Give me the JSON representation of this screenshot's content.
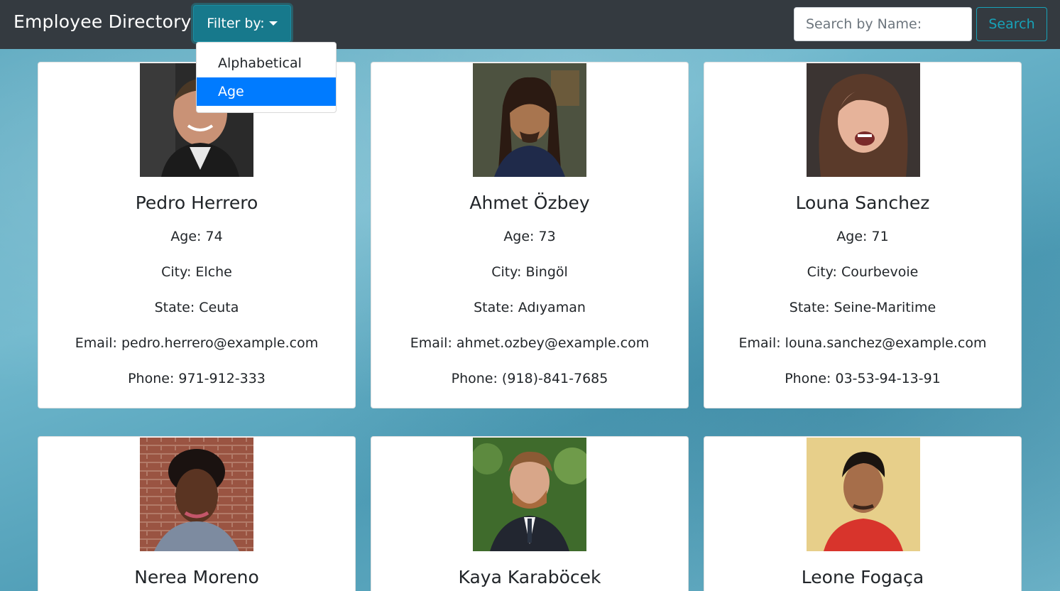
{
  "navbar": {
    "brand": "Employee Directory",
    "filter_label": "Filter by:",
    "search_placeholder": "Search by Name:",
    "search_button": "Search"
  },
  "filter_menu": {
    "items": [
      {
        "label": "Alphabetical",
        "active": false
      },
      {
        "label": "Age",
        "active": true
      }
    ]
  },
  "employees": [
    {
      "name": "Pedro Herrero",
      "age": "Age: 74",
      "city": "City: Elche",
      "state": "State: Ceuta",
      "email": "Email: pedro.herrero@example.com",
      "phone": "Phone: 971-912-333"
    },
    {
      "name": "Ahmet Özbey",
      "age": "Age: 73",
      "city": "City: Bingöl",
      "state": "State: Adıyaman",
      "email": "Email: ahmet.ozbey@example.com",
      "phone": "Phone: (918)-841-7685"
    },
    {
      "name": "Louna Sanchez",
      "age": "Age: 71",
      "city": "City: Courbevoie",
      "state": "State: Seine-Maritime",
      "email": "Email: louna.sanchez@example.com",
      "phone": "Phone: 03-53-94-13-91"
    },
    {
      "name": "Nerea Moreno"
    },
    {
      "name": "Kaya Karaböcek"
    },
    {
      "name": "Leone Fogaça"
    }
  ],
  "colors": {
    "navbar_bg": "#343a40",
    "filter_button": "#17798c",
    "search_outline": "#17a2b8",
    "active_menu_item": "#007bff"
  }
}
